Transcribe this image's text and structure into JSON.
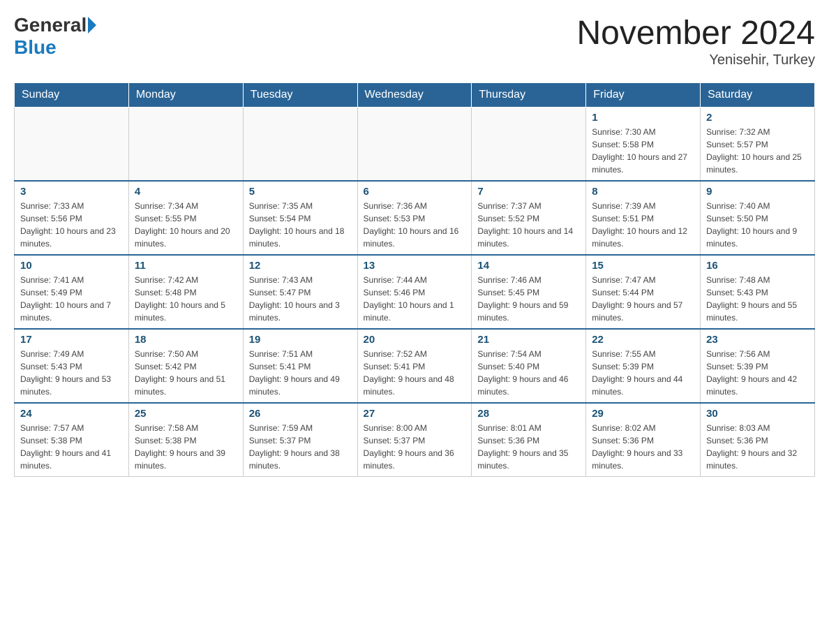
{
  "header": {
    "logo_general": "General",
    "logo_blue": "Blue",
    "month_title": "November 2024",
    "location": "Yenisehir, Turkey"
  },
  "calendar": {
    "days_of_week": [
      "Sunday",
      "Monday",
      "Tuesday",
      "Wednesday",
      "Thursday",
      "Friday",
      "Saturday"
    ],
    "weeks": [
      [
        {
          "day": "",
          "info": ""
        },
        {
          "day": "",
          "info": ""
        },
        {
          "day": "",
          "info": ""
        },
        {
          "day": "",
          "info": ""
        },
        {
          "day": "",
          "info": ""
        },
        {
          "day": "1",
          "info": "Sunrise: 7:30 AM\nSunset: 5:58 PM\nDaylight: 10 hours and 27 minutes."
        },
        {
          "day": "2",
          "info": "Sunrise: 7:32 AM\nSunset: 5:57 PM\nDaylight: 10 hours and 25 minutes."
        }
      ],
      [
        {
          "day": "3",
          "info": "Sunrise: 7:33 AM\nSunset: 5:56 PM\nDaylight: 10 hours and 23 minutes."
        },
        {
          "day": "4",
          "info": "Sunrise: 7:34 AM\nSunset: 5:55 PM\nDaylight: 10 hours and 20 minutes."
        },
        {
          "day": "5",
          "info": "Sunrise: 7:35 AM\nSunset: 5:54 PM\nDaylight: 10 hours and 18 minutes."
        },
        {
          "day": "6",
          "info": "Sunrise: 7:36 AM\nSunset: 5:53 PM\nDaylight: 10 hours and 16 minutes."
        },
        {
          "day": "7",
          "info": "Sunrise: 7:37 AM\nSunset: 5:52 PM\nDaylight: 10 hours and 14 minutes."
        },
        {
          "day": "8",
          "info": "Sunrise: 7:39 AM\nSunset: 5:51 PM\nDaylight: 10 hours and 12 minutes."
        },
        {
          "day": "9",
          "info": "Sunrise: 7:40 AM\nSunset: 5:50 PM\nDaylight: 10 hours and 9 minutes."
        }
      ],
      [
        {
          "day": "10",
          "info": "Sunrise: 7:41 AM\nSunset: 5:49 PM\nDaylight: 10 hours and 7 minutes."
        },
        {
          "day": "11",
          "info": "Sunrise: 7:42 AM\nSunset: 5:48 PM\nDaylight: 10 hours and 5 minutes."
        },
        {
          "day": "12",
          "info": "Sunrise: 7:43 AM\nSunset: 5:47 PM\nDaylight: 10 hours and 3 minutes."
        },
        {
          "day": "13",
          "info": "Sunrise: 7:44 AM\nSunset: 5:46 PM\nDaylight: 10 hours and 1 minute."
        },
        {
          "day": "14",
          "info": "Sunrise: 7:46 AM\nSunset: 5:45 PM\nDaylight: 9 hours and 59 minutes."
        },
        {
          "day": "15",
          "info": "Sunrise: 7:47 AM\nSunset: 5:44 PM\nDaylight: 9 hours and 57 minutes."
        },
        {
          "day": "16",
          "info": "Sunrise: 7:48 AM\nSunset: 5:43 PM\nDaylight: 9 hours and 55 minutes."
        }
      ],
      [
        {
          "day": "17",
          "info": "Sunrise: 7:49 AM\nSunset: 5:43 PM\nDaylight: 9 hours and 53 minutes."
        },
        {
          "day": "18",
          "info": "Sunrise: 7:50 AM\nSunset: 5:42 PM\nDaylight: 9 hours and 51 minutes."
        },
        {
          "day": "19",
          "info": "Sunrise: 7:51 AM\nSunset: 5:41 PM\nDaylight: 9 hours and 49 minutes."
        },
        {
          "day": "20",
          "info": "Sunrise: 7:52 AM\nSunset: 5:41 PM\nDaylight: 9 hours and 48 minutes."
        },
        {
          "day": "21",
          "info": "Sunrise: 7:54 AM\nSunset: 5:40 PM\nDaylight: 9 hours and 46 minutes."
        },
        {
          "day": "22",
          "info": "Sunrise: 7:55 AM\nSunset: 5:39 PM\nDaylight: 9 hours and 44 minutes."
        },
        {
          "day": "23",
          "info": "Sunrise: 7:56 AM\nSunset: 5:39 PM\nDaylight: 9 hours and 42 minutes."
        }
      ],
      [
        {
          "day": "24",
          "info": "Sunrise: 7:57 AM\nSunset: 5:38 PM\nDaylight: 9 hours and 41 minutes."
        },
        {
          "day": "25",
          "info": "Sunrise: 7:58 AM\nSunset: 5:38 PM\nDaylight: 9 hours and 39 minutes."
        },
        {
          "day": "26",
          "info": "Sunrise: 7:59 AM\nSunset: 5:37 PM\nDaylight: 9 hours and 38 minutes."
        },
        {
          "day": "27",
          "info": "Sunrise: 8:00 AM\nSunset: 5:37 PM\nDaylight: 9 hours and 36 minutes."
        },
        {
          "day": "28",
          "info": "Sunrise: 8:01 AM\nSunset: 5:36 PM\nDaylight: 9 hours and 35 minutes."
        },
        {
          "day": "29",
          "info": "Sunrise: 8:02 AM\nSunset: 5:36 PM\nDaylight: 9 hours and 33 minutes."
        },
        {
          "day": "30",
          "info": "Sunrise: 8:03 AM\nSunset: 5:36 PM\nDaylight: 9 hours and 32 minutes."
        }
      ]
    ]
  }
}
